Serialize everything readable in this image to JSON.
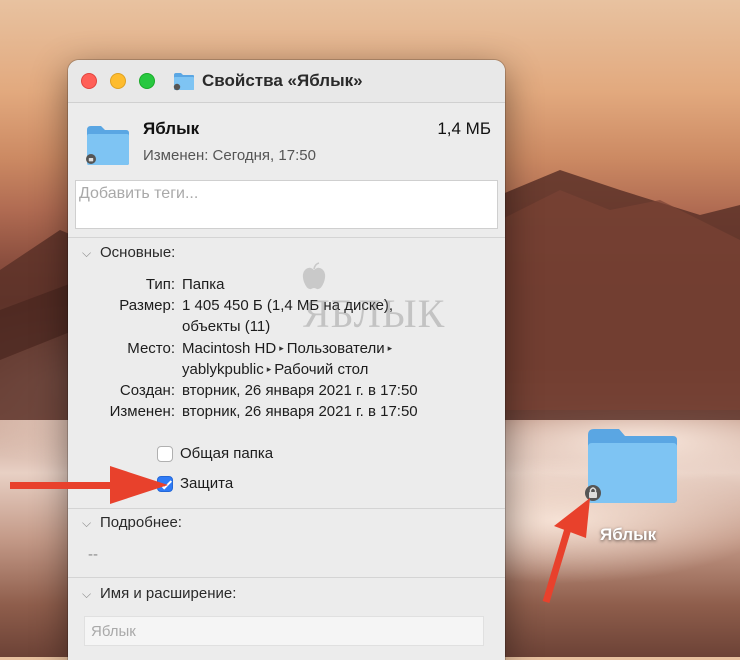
{
  "window": {
    "title": "Свойства «Яблык»",
    "folder_name": "Яблык",
    "folder_size": "1,4 МБ",
    "modified_summary": "Изменен: Сегодня, 17:50",
    "tags_placeholder": "Добавить теги..."
  },
  "general": {
    "heading": "Основные:",
    "rows": [
      {
        "label": "Тип:",
        "value": "Папка"
      },
      {
        "label": "Размер:",
        "value": "1 405 450 Б (1,4 МБ на диске),"
      },
      {
        "label": "",
        "value": "объекты (11)"
      },
      {
        "label": "Место:",
        "value_parts": [
          "Macintosh HD",
          "Пользователи"
        ]
      },
      {
        "label": "",
        "value_parts": [
          "yablykpublic",
          "Рабочий стол"
        ]
      },
      {
        "label": "Создан:",
        "value": "вторник, 26 января 2021 г. в 17:50"
      },
      {
        "label": "Изменен:",
        "value": "вторник, 26 января 2021 г. в 17:50"
      }
    ],
    "shared_folder_label": "Общая папка",
    "shared_folder_checked": false,
    "locked_label": "Защита",
    "locked_checked": true
  },
  "more_info": {
    "heading": "Подробнее:",
    "value": "--"
  },
  "name_extension": {
    "heading": "Имя и расширение:",
    "field_value": "Яблык"
  },
  "desktop": {
    "folder_label": "Яблык"
  },
  "watermark": "ЯБЛЫК",
  "colors": {
    "accent": "#2f7bf6",
    "folder": "#6fb8ef",
    "annotation_arrow": "#e8412c"
  },
  "icons": [
    "folder-icon",
    "lock-badge-icon",
    "chevron-down-icon",
    "checkmark-icon",
    "apple-logo-icon"
  ]
}
